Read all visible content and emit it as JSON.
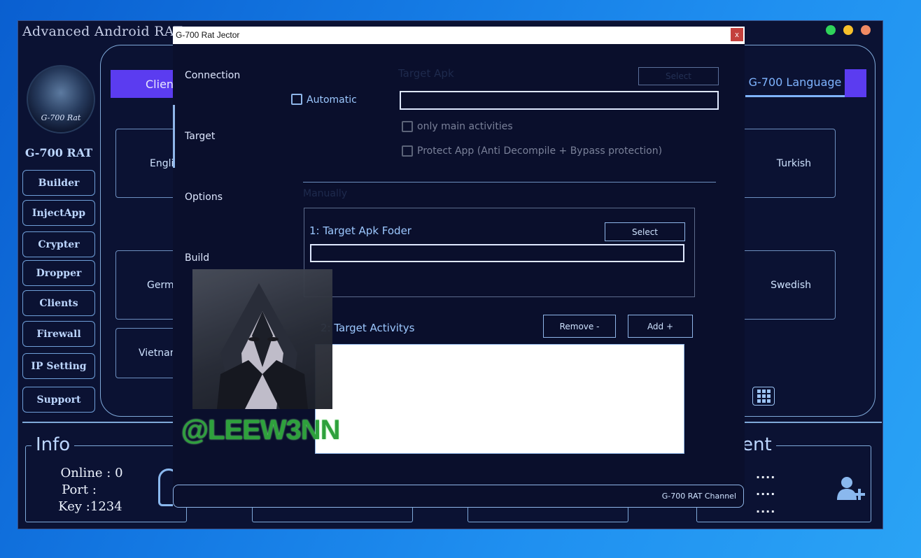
{
  "app": {
    "title": "Advanced Android RAT",
    "brand": "G-700 RAT",
    "avatar_caption": "G-700 Rat",
    "sidebar": [
      {
        "label": "Builder"
      },
      {
        "label": "InjectApp"
      },
      {
        "label": "Crypter"
      },
      {
        "label": "Dropper"
      },
      {
        "label": "Clients"
      },
      {
        "label": "Firewall"
      },
      {
        "label": "IP Setting"
      },
      {
        "label": "Support"
      }
    ],
    "tabs": {
      "clients": "Client",
      "language": "G-700 Language"
    },
    "languages": {
      "english": "Engli",
      "turkish": "Turkish",
      "german": "Germ",
      "swedish": "Swedish",
      "vietnamese": "Vietnam"
    },
    "info": {
      "title": "Info",
      "online": "Online : 0",
      "port": "Port :",
      "key": "Key :1234"
    },
    "client_panel": {
      "title_fragment": "ent",
      "lines": [
        "....",
        "....",
        "...."
      ]
    },
    "window_controls": {
      "colors": {
        "close": "#f08a63",
        "minimize": "#f6c02b",
        "maximize": "#2fd35a"
      }
    }
  },
  "dialog": {
    "title": "G-700 Rat Jector",
    "close_label": "x",
    "nav": [
      "Connection",
      "Target",
      "Options",
      "Build"
    ],
    "active_nav": "Target",
    "automatic": {
      "label": "Automatic",
      "target_apk_label": "Target Apk",
      "select_label": "Select",
      "target_apk_value": "",
      "only_main_label": "only main activities",
      "protect_label": "Protect App (Anti Decompile + Bypass protection)"
    },
    "manual": {
      "label": "Manually",
      "folder_label": "1: Target Apk Foder",
      "select_label": "Select",
      "folder_value": "",
      "activities_label": "2: Target Activitys",
      "remove_label": "Remove -",
      "add_label": "Add +",
      "activities": []
    },
    "watermark": "@LEEW3NN",
    "status": "G-700 RAT Channel"
  },
  "icons": {
    "close": "close-icon",
    "grid": "grid-icon",
    "user_add": "user-add-icon",
    "user": "user-icon"
  }
}
